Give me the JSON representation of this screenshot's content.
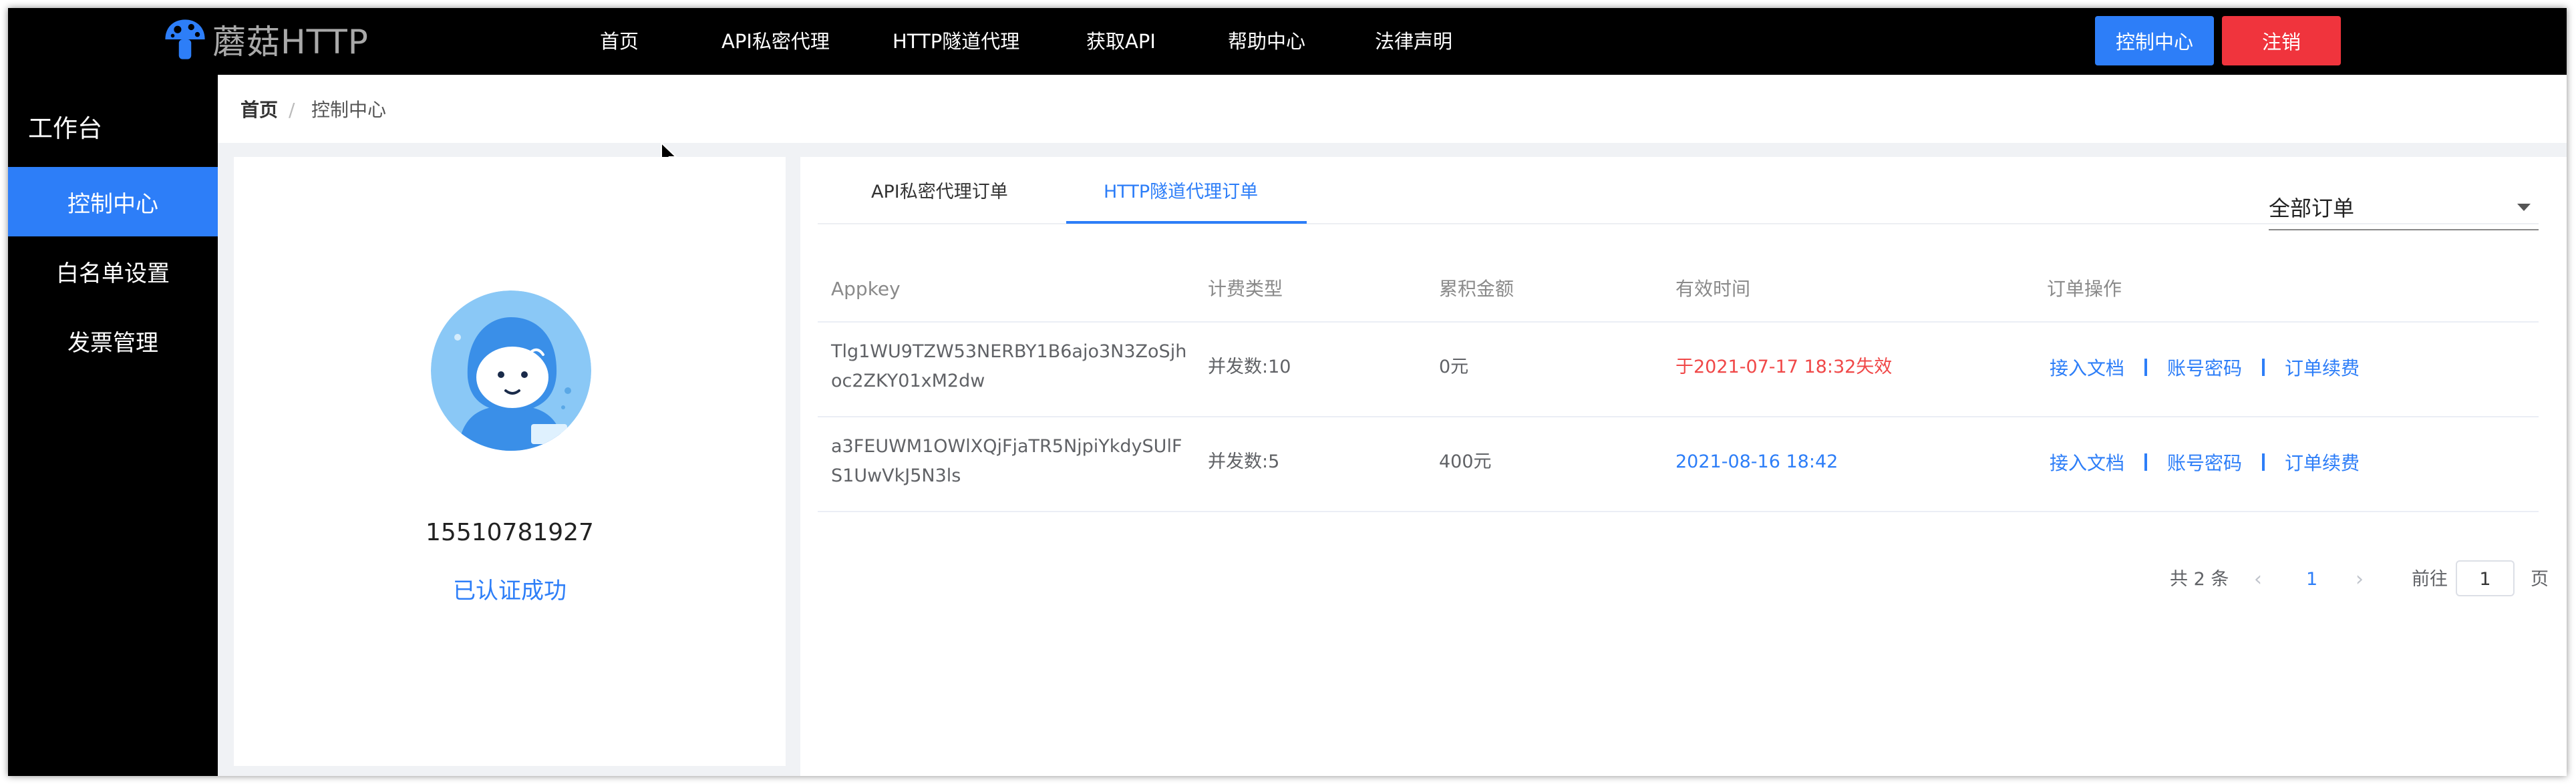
{
  "header": {
    "brand": "蘑菇HTTP",
    "nav": [
      "首页",
      "API私密代理",
      "HTTP隧道代理",
      "获取API",
      "帮助中心",
      "法律声明"
    ],
    "control_button": "控制中心",
    "logout_button": "注销",
    "accent_color": "#2d7ef8",
    "danger_color": "#f0343d"
  },
  "sidebar": {
    "title": "工作台",
    "items": [
      {
        "label": "控制中心",
        "active": true
      },
      {
        "label": "白名单设置",
        "active": false
      },
      {
        "label": "发票管理",
        "active": false
      }
    ]
  },
  "breadcrumb": {
    "home": "首页",
    "separator": "/",
    "current": "控制中心"
  },
  "profile": {
    "avatar_icon": "cartoon-avatar-icon",
    "phone": "15510781927",
    "status": "已认证成功"
  },
  "orders": {
    "tabs": [
      "API私密代理订单",
      "HTTP隧道代理订单"
    ],
    "active_tab": 1,
    "filter": "全部订单",
    "columns": [
      "Appkey",
      "计费类型",
      "累积金额",
      "有效时间",
      "订单操作"
    ],
    "rows": [
      {
        "appkey": "Tlg1WU9TZW53NERBY1B6ajo3N3ZoSjhoc2ZKY01xM2dw",
        "billing": "并发数:10",
        "amount": "0元",
        "valid_time": "于2021-07-17 18:32失效",
        "status": "expired",
        "ops": [
          "接入文档",
          "账号密码",
          "订单续费"
        ]
      },
      {
        "appkey": "a3FEUWM1OWlXQjFjaTR5NjpiYkdySUlFS1UwVkJ5N3ls",
        "billing": "并发数:5",
        "amount": "400元",
        "valid_time": "2021-08-16 18:42",
        "status": "active",
        "ops": [
          "接入文档",
          "账号密码",
          "订单续费"
        ]
      }
    ],
    "pagination": {
      "total_text": "共 2 条",
      "prev": "‹",
      "current_page": "1",
      "next": "›",
      "goto_label": "前往",
      "goto_value": "1",
      "page_unit": "页"
    }
  }
}
